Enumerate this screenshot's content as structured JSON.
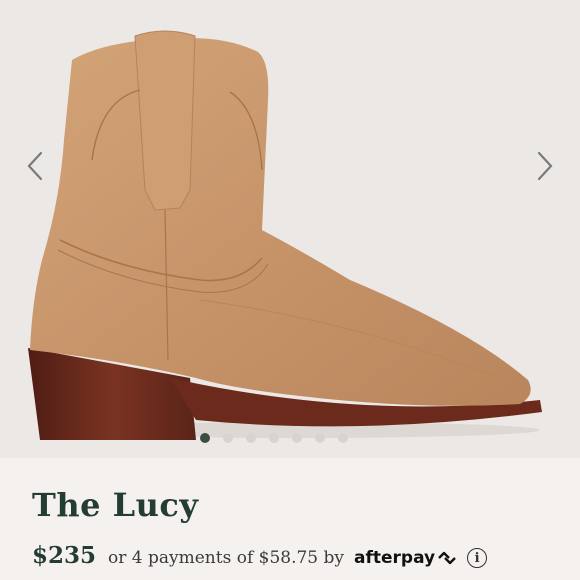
{
  "product": {
    "title": "The Lucy",
    "price": "$235",
    "installments": "or 4 payments of $58.75 by",
    "afterpay_brand": "afterpay",
    "info_icon": "info-icon",
    "info_glyph": "i"
  },
  "gallery": {
    "image_alt": "tan suede ankle boot",
    "prev_icon": "chevron-left-icon",
    "next_icon": "chevron-right-icon",
    "dot_count": 7,
    "active_dot": 1
  },
  "colors": {
    "accent_dark_green": "#243d33",
    "suede": "#c8956a",
    "heel": "#6b2a1c"
  }
}
